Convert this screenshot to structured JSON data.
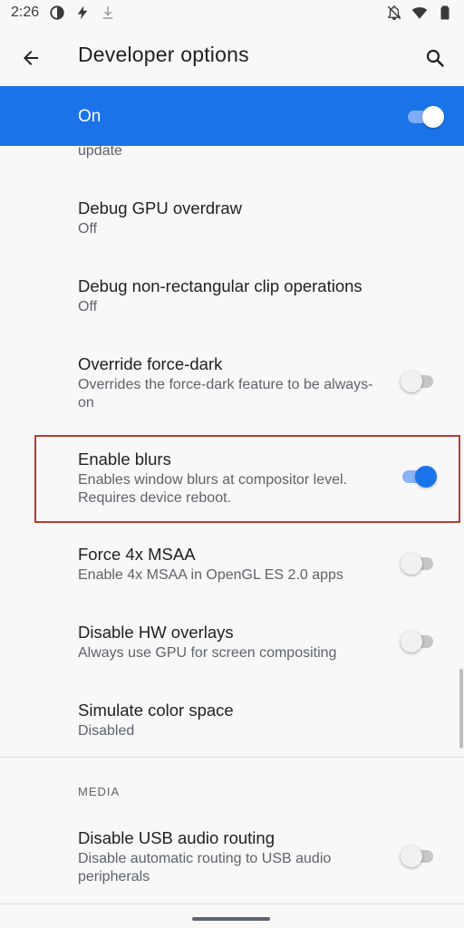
{
  "status_bar": {
    "time": "2:26",
    "left_icons": [
      "data-saver-icon",
      "bolt-icon",
      "download-icon"
    ],
    "right_icons": [
      "notifications-off-icon",
      "wifi-icon",
      "battery-icon"
    ]
  },
  "app_bar": {
    "title": "Developer options",
    "back_icon": "arrow-back-icon",
    "search_icon": "search-icon"
  },
  "master_switch": {
    "label": "On",
    "checked": true,
    "color": "#1a73e8"
  },
  "cut_off_summary": "update",
  "settings": [
    {
      "title": "Debug GPU overdraw",
      "summary": "Off"
    },
    {
      "title": "Debug non-rectangular clip operations",
      "summary": "Off"
    },
    {
      "title": "Override force-dark",
      "summary": "Overrides the force-dark feature to be always-on",
      "toggle": false
    },
    {
      "title": "Enable blurs",
      "summary": "Enables window blurs at compositor level. Requires device reboot.",
      "toggle": true,
      "highlighted": true
    },
    {
      "title": "Force 4x MSAA",
      "summary": "Enable 4x MSAA in OpenGL ES 2.0 apps",
      "toggle": false
    },
    {
      "title": "Disable HW overlays",
      "summary": "Always use GPU for screen compositing",
      "toggle": false
    },
    {
      "title": "Simulate color space",
      "summary": "Disabled"
    }
  ],
  "media_section": {
    "header": "MEDIA",
    "items": [
      {
        "title": "Disable USB audio routing",
        "summary": "Disable automatic routing to USB audio peripherals",
        "toggle": false
      }
    ]
  },
  "colors": {
    "accent": "#1a73e8",
    "highlight_border": "#c0392b",
    "background": "#f8f8f8"
  }
}
